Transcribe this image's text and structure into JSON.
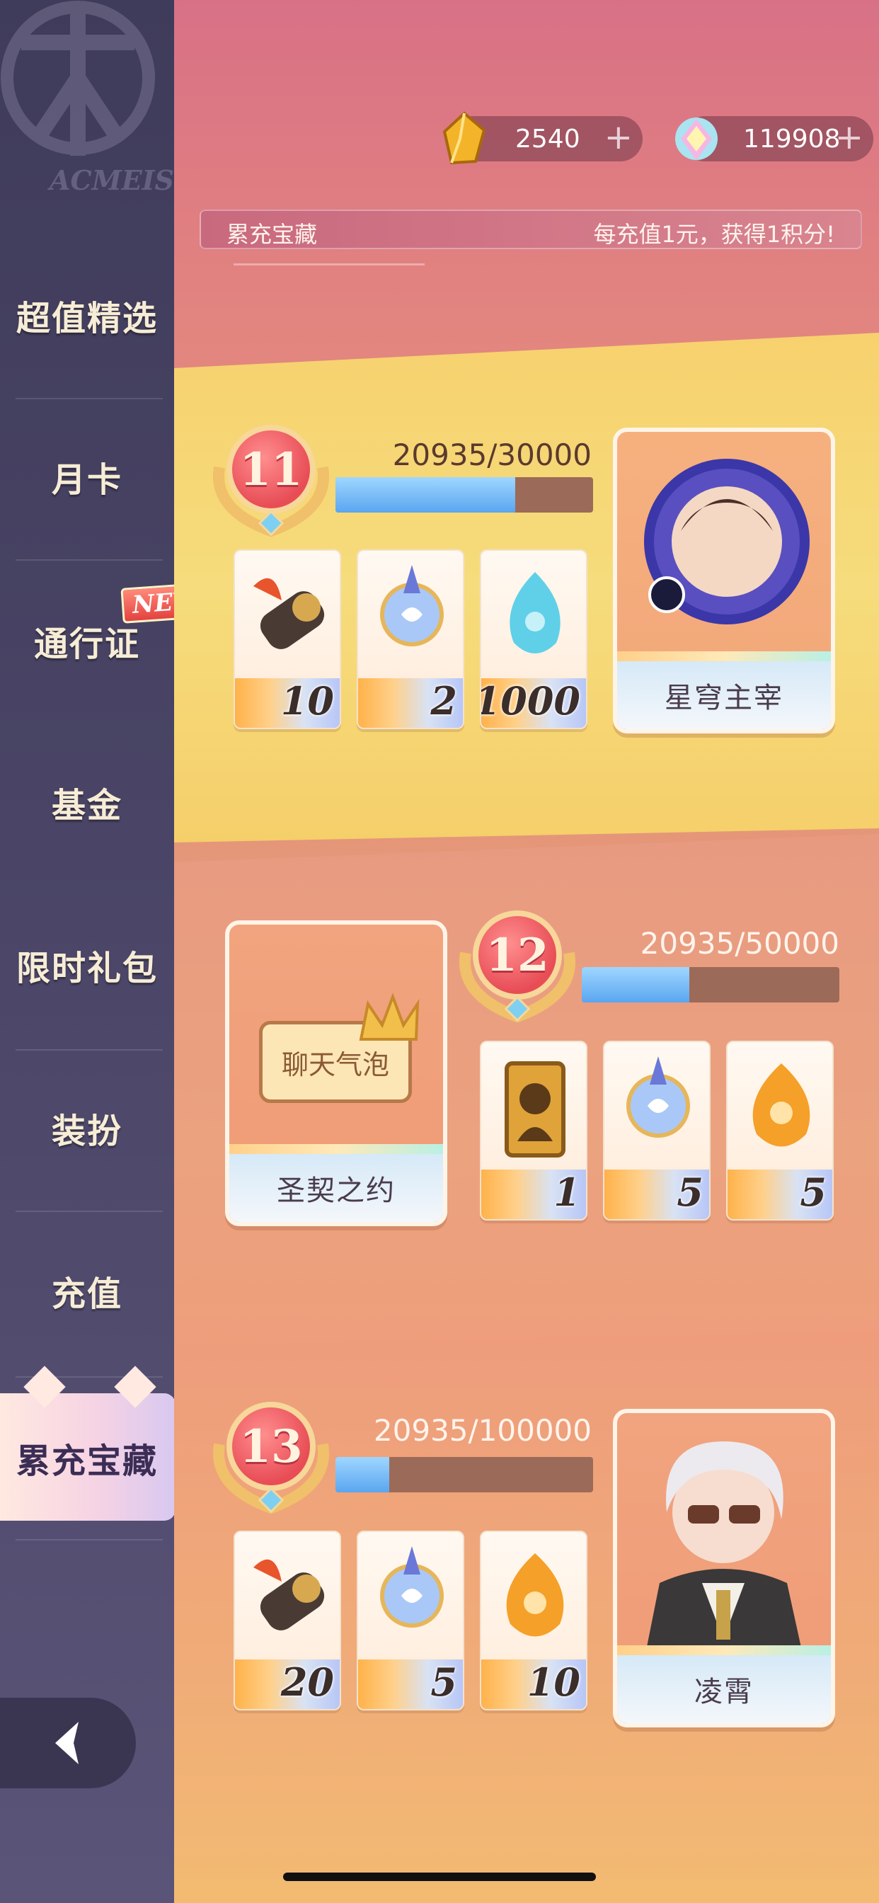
{
  "sidebar": {
    "logo_text": "ACMEIS",
    "items": [
      {
        "label": "超值精选"
      },
      {
        "label": "月卡"
      },
      {
        "label": "通行证"
      },
      {
        "label": "基金"
      },
      {
        "label": "限时礼包"
      },
      {
        "label": "装扮"
      },
      {
        "label": "充值"
      },
      {
        "label": "累充宝藏"
      }
    ],
    "new_badge": "NEW!"
  },
  "currencies": [
    {
      "value": "2540"
    },
    {
      "value": "119908"
    }
  ],
  "banner": {
    "title": "累充宝藏",
    "description": "每充值1元，获得1积分!"
  },
  "tiers": [
    {
      "level": "11",
      "progress_text": "20935/30000",
      "progress_fraction": 0.6978,
      "items": [
        {
          "qty": "10"
        },
        {
          "qty": "2"
        },
        {
          "qty": "1000"
        }
      ],
      "reward_name": "星穹主宰"
    },
    {
      "level": "12",
      "progress_text": "20935/50000",
      "progress_fraction": 0.4187,
      "items": [
        {
          "qty": "1"
        },
        {
          "qty": "5"
        },
        {
          "qty": "5"
        }
      ],
      "reward_name": "圣契之约",
      "reward_bubble": "聊天气泡"
    },
    {
      "level": "13",
      "progress_text": "20935/100000",
      "progress_fraction": 0.2094,
      "items": [
        {
          "qty": "20"
        },
        {
          "qty": "5"
        },
        {
          "qty": "10"
        }
      ],
      "reward_name": "凌霄"
    }
  ],
  "colors": {
    "sidebar_bg": "#4a4566",
    "progress_fill": "#5aa6f0",
    "medal_red": "#e84d56"
  }
}
